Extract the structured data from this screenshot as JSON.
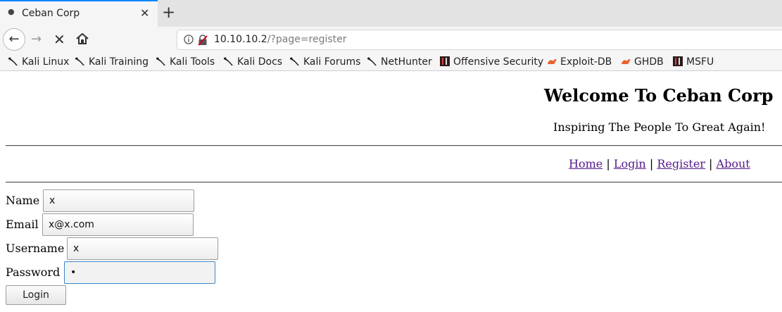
{
  "browser": {
    "tab_title": "Ceban Corp",
    "url_host": "10.10.10.2",
    "url_path": "/?page=register",
    "bookmarks": [
      {
        "label": "Kali Linux",
        "icon": "kali-dragon-icon"
      },
      {
        "label": "Kali Training",
        "icon": "kali-dragon-icon"
      },
      {
        "label": "Kali Tools",
        "icon": "kali-dragon-icon"
      },
      {
        "label": "Kali Docs",
        "icon": "kali-dragon-icon"
      },
      {
        "label": "Kali Forums",
        "icon": "kali-dragon-icon"
      },
      {
        "label": "NetHunter",
        "icon": "kali-dragon-icon"
      },
      {
        "label": "Offensive Security",
        "icon": "offsec-icon"
      },
      {
        "label": "Exploit-DB",
        "icon": "exploitdb-icon"
      },
      {
        "label": "GHDB",
        "icon": "exploitdb-icon"
      },
      {
        "label": "MSFU",
        "icon": "offsec-icon"
      }
    ]
  },
  "page": {
    "title": "Welcome To Ceban Corp",
    "subtitle": "Inspiring The People To Great Again!",
    "nav": {
      "home": "Home",
      "login": "Login",
      "register": "Register",
      "about": "About",
      "separator": "|"
    },
    "form": {
      "name_label": "Name",
      "name_value": "x",
      "email_label": "Email",
      "email_value": "x@x.com",
      "username_label": "Username",
      "username_value": "x",
      "password_label": "Password",
      "password_value": "•",
      "submit_label": "Login"
    }
  },
  "colors": {
    "tab_accent": "#0a84ff",
    "link": "#551a8b",
    "focus_border": "#3b86c4"
  }
}
